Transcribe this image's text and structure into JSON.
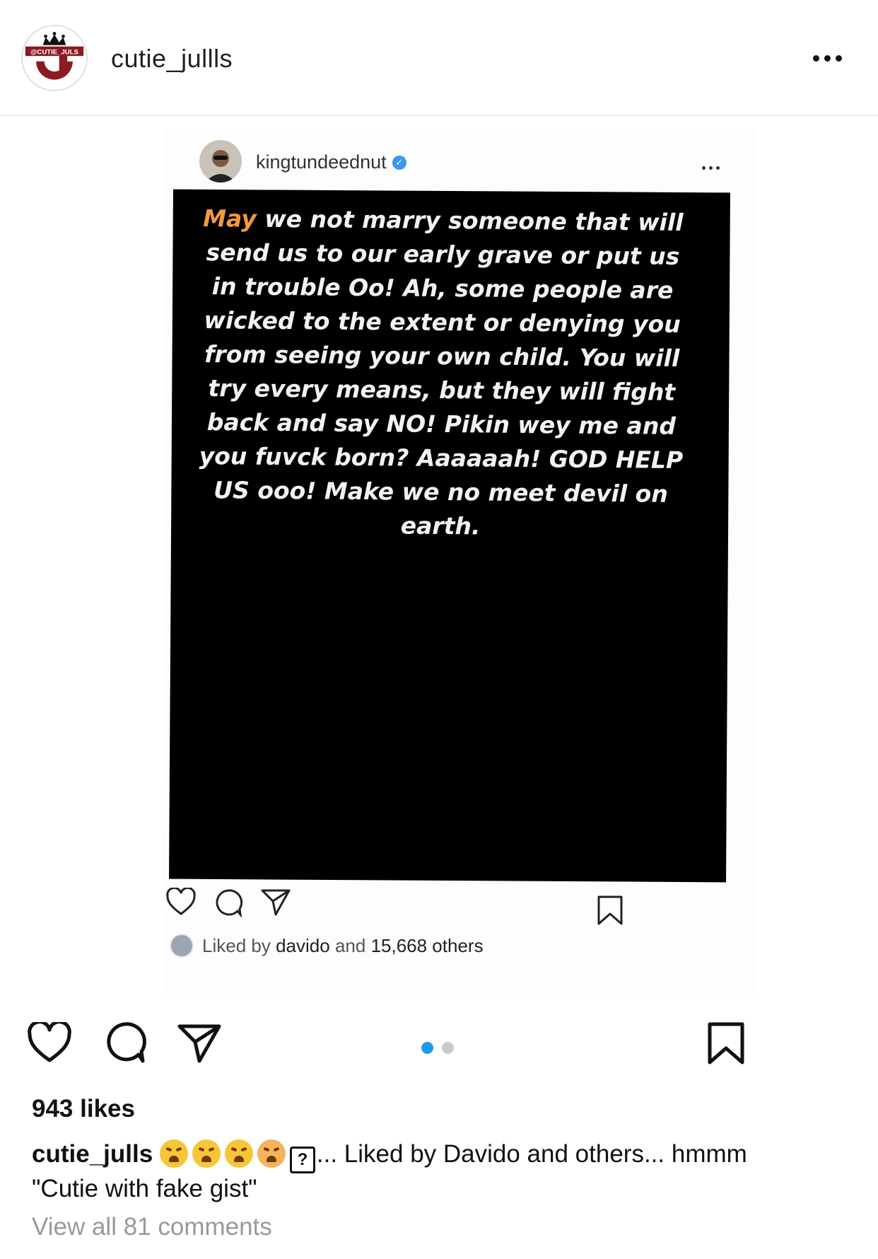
{
  "post": {
    "username": "cutie_jullls",
    "avatar_text": "@CUTIE_JULS",
    "more_icon": "more-horizontal-icon"
  },
  "embedded": {
    "username": "kingtundeednut",
    "verified": true,
    "quote_highlight": "May",
    "quote_rest": "we not marry someone that will send us to our early grave or put us in trouble Oo! Ah, some people are wicked to the extent or denying you from seeing your own child. You will try every means, but they will fight back and say NO! Pikin wey me and you fuvck born? Aaaaaah! GOD HELP US ooo! Make we no meet devil on earth.",
    "liked_prefix": "Liked by",
    "liked_user": "davido",
    "liked_and": "and",
    "liked_count": "15,668 others"
  },
  "likes": "943 likes",
  "caption": {
    "user": "cutie_julls",
    "text_after_emoji": "... Liked by Davido and others... hmmm",
    "line2": "\"Cutie with fake gist\""
  },
  "view_comments": "View all 81 comments",
  "carousel": {
    "count": 2,
    "active": 0
  },
  "colors": {
    "accent": "#1d9bf0",
    "highlight": "#f39a3b",
    "card": "#000000"
  }
}
